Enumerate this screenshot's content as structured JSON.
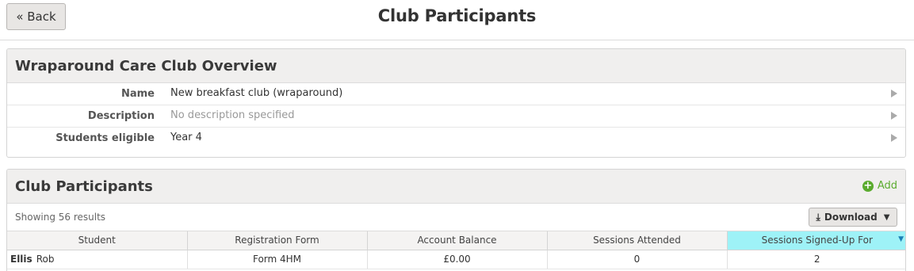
{
  "header": {
    "back_label": "« Back",
    "title": "Club Participants"
  },
  "overview": {
    "title": "Wraparound Care Club Overview",
    "rows": [
      {
        "label": "Name",
        "value": "New breakfast club (wraparound)"
      },
      {
        "label": "Description",
        "value": "No description specified"
      },
      {
        "label": "Students eligible",
        "value": "Year 4"
      }
    ]
  },
  "participants": {
    "title": "Club Participants",
    "add_label": "Add",
    "showing_text": "Showing 56 results",
    "download_label": "Download",
    "columns": [
      "Student",
      "Registration Form",
      "Account Balance",
      "Sessions Attended",
      "Sessions Signed-Up For"
    ],
    "sorted_column": "Sessions Signed-Up For",
    "rows": [
      {
        "last_name": "Ellis",
        "first_name": "Rob",
        "form": "Form 4HM",
        "balance": "£0.00",
        "attended": "0",
        "signed_up": "2"
      }
    ]
  },
  "colors": {
    "accent_green": "#5aab2e",
    "sorted_header": "#9ef2f7"
  }
}
